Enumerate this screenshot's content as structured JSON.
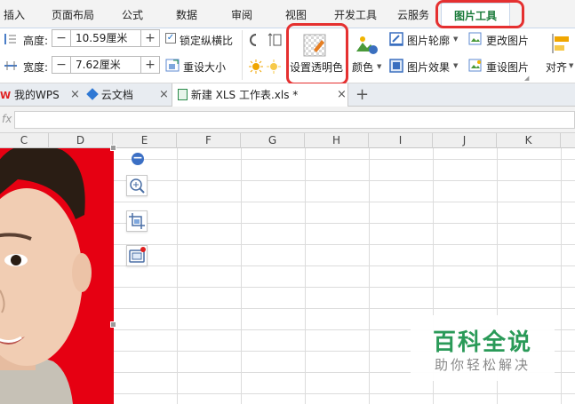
{
  "menu": {
    "tabs": [
      "插入",
      "页面布局",
      "公式",
      "数据",
      "审阅",
      "视图",
      "开发工具",
      "云服务"
    ],
    "active_tab": "图片工具"
  },
  "ribbon": {
    "height_label": "高度:",
    "height_value": "10.59厘米",
    "width_label": "宽度:",
    "width_value": "7.62厘米",
    "minus": "−",
    "plus": "+",
    "lock_ratio_label": "锁定纵横比",
    "reset_size_label": "重设大小",
    "set_transparent_label": "设置透明色",
    "color_label": "颜色",
    "outline_label": "图片轮廓",
    "effect_label": "图片效果",
    "change_picture_label": "更改图片",
    "reset_picture_label": "重设图片",
    "align_label": "对齐"
  },
  "doc_tabs": {
    "tabs": [
      "我的WPS",
      "云文档",
      "新建 XLS 工作表.xls *"
    ],
    "close": "×",
    "new_tab": "+"
  },
  "formula_bar": {
    "fx": "fx"
  },
  "columns": [
    "C",
    "D",
    "E",
    "F",
    "G",
    "H",
    "I",
    "J",
    "K"
  ],
  "float_toolbar": {
    "minus": "−"
  },
  "watermark": {
    "title": "百科全说",
    "subtitle": "助你轻松解决"
  },
  "colors": {
    "accent_green": "#1a7a3a",
    "highlight_red": "#e53030",
    "photo_background": "#e60012",
    "watermark_green": "#2a9a58"
  }
}
